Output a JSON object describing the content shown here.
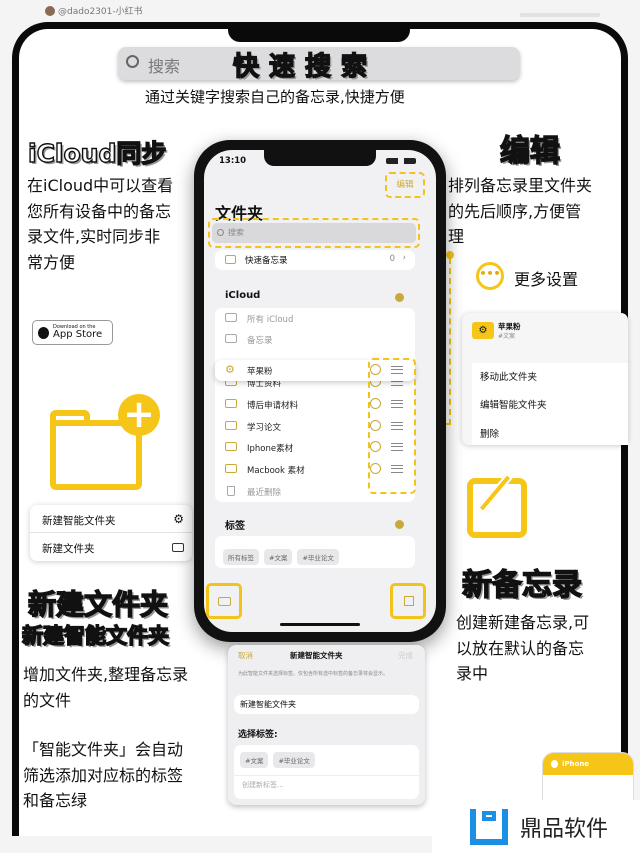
{
  "watermark_user": "@dado2301-小红书",
  "search_section": {
    "search_placeholder": "搜索",
    "title": "快速搜索",
    "subtitle": "通过关键字搜索自己的备忘录,快捷方便"
  },
  "icloud_section": {
    "title": "iCloud同步",
    "lines": [
      "在iCloud中可以查看",
      "您所有设备中的备忘",
      "录文件,实时同步非",
      "常方便"
    ],
    "badge_small": "Download on the",
    "badge_big": "App Store"
  },
  "edit_section": {
    "title": "编辑",
    "lines": [
      "排列备忘录里文件夹",
      "的先后顺序,方便管",
      "理"
    ],
    "more_label": "更多设置"
  },
  "context_menu": {
    "folder_name": "苹果粉",
    "folder_tag": "#文案",
    "items": [
      "移动此文件夹",
      "编辑智能文件夹",
      "删除"
    ]
  },
  "new_menu": {
    "items": [
      "新建智能文件夹",
      "新建文件夹"
    ]
  },
  "new_folder_section": {
    "title": "新建文件夹",
    "subtitle": "新建智能文件夹",
    "lines1": [
      "增加文件夹,整理备忘录",
      "的文件"
    ],
    "lines2": [
      "「智能文件夹」会自动",
      "筛选添加对应标的标签",
      "和备忘绿"
    ]
  },
  "new_note_section": {
    "title": "新备忘录",
    "lines": [
      "创建新建备忘录,可",
      "以放在默认的备忘",
      "录中"
    ]
  },
  "phone": {
    "time": "13:10",
    "edit": "编辑",
    "title": "文件夹",
    "search_placeholder": "搜索",
    "quick_notes": "快速备忘录",
    "quick_count": "0",
    "icloud_header": "iCloud",
    "icloud_rows": [
      "所有 iCloud",
      "备忘录"
    ],
    "dragging": "苹果粉",
    "folders": [
      "博士资料",
      "博后申请材料",
      "学习论文",
      "Iphone素材",
      "Macbook 素材"
    ],
    "recently_deleted": "最近删除",
    "tags_header": "标签",
    "tags": [
      "所有标签",
      "#文案",
      "#毕业论文"
    ]
  },
  "sheet": {
    "cancel": "取消",
    "title": "新建智能文件夹",
    "done": "完成",
    "desc": "为此智能文件夹选择标签。仅包含所有选中标签的备忘录将会显示。",
    "name_value": "新建智能文件夹",
    "choose_tags": "选择标签:",
    "tags": [
      "#文案",
      "#毕业论文"
    ],
    "new_tag_placeholder": "创建新标签..."
  },
  "notes_icon_label": "iPhone",
  "logo_text": "鼎品软件",
  "colors": {
    "accent": "#f5c518",
    "folder_icon": "#c9a93a",
    "logo_blue": "#1a8fe3"
  }
}
